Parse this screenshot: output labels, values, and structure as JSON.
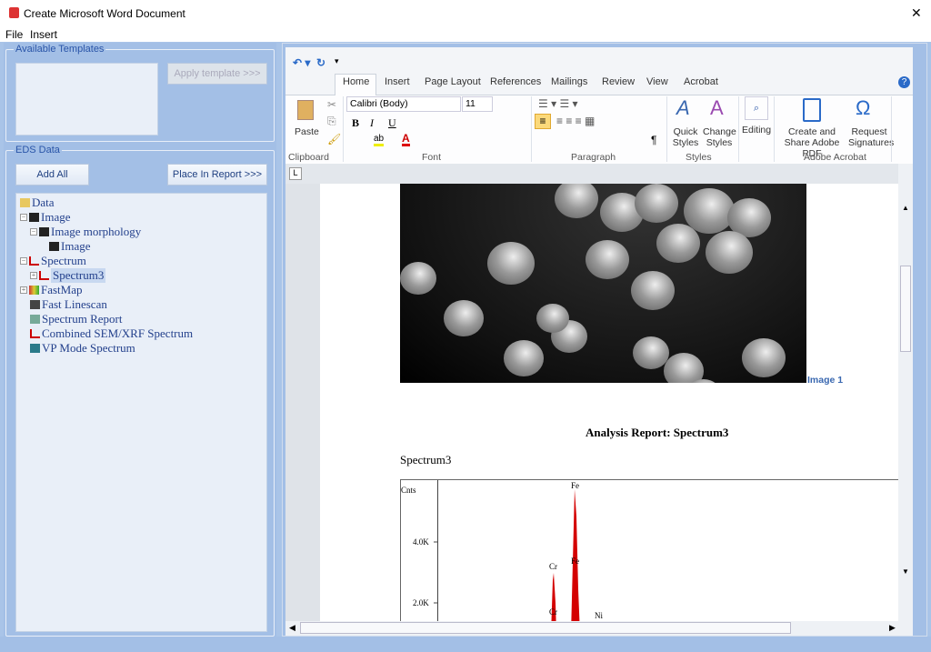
{
  "window": {
    "title": "Create Microsoft Word Document",
    "close": "✕"
  },
  "menu": {
    "items": [
      "File",
      "Insert"
    ]
  },
  "templates": {
    "label": "Available Templates",
    "apply": "Apply template >>>"
  },
  "eds": {
    "label": "EDS Data",
    "add_all": "Add All",
    "place": "Place In Report >>>",
    "tree": [
      {
        "label": "Data"
      },
      {
        "label": "Image"
      },
      {
        "label": "Image morphology"
      },
      {
        "label": "Image"
      },
      {
        "label": "Spectrum"
      },
      {
        "label": "Spectrum3",
        "selected": true
      },
      {
        "label": "FastMap"
      },
      {
        "label": "Fast Linescan"
      },
      {
        "label": "Spectrum Report"
      },
      {
        "label": "Combined SEM/XRF Spectrum"
      },
      {
        "label": "VP Mode Spectrum"
      }
    ]
  },
  "ribbon": {
    "tabs": [
      "Home",
      "Insert",
      "Page Layout",
      "References",
      "Mailings",
      "Review",
      "View",
      "Acrobat"
    ],
    "active_tab": "Home",
    "font_name": "Calibri (Body)",
    "font_size": "11",
    "paste": "Paste",
    "quick_styles": "Quick Styles",
    "change_styles": "Change Styles",
    "editing": "Editing",
    "create_pdf": "Create and Share Adobe PDF",
    "request_sig": "Request Signatures",
    "groups": [
      "Clipboard",
      "Font",
      "Paragraph",
      "Styles",
      "Adobe Acrobat"
    ]
  },
  "document": {
    "image_caption": "Image 1",
    "report_title": "Analysis Report: Spectrum3",
    "spectrum_heading": "Spectrum3",
    "spectrum": {
      "ylabel": "Cnts",
      "yticks": [
        "4.0K",
        "2.0K"
      ],
      "peaks": [
        "Fe",
        "Fe",
        "Cr",
        "Cr",
        "Ni"
      ]
    }
  },
  "colors": {
    "panel": "#a3bfe6",
    "accent": "#2a55a8",
    "peak": "#d40000"
  }
}
